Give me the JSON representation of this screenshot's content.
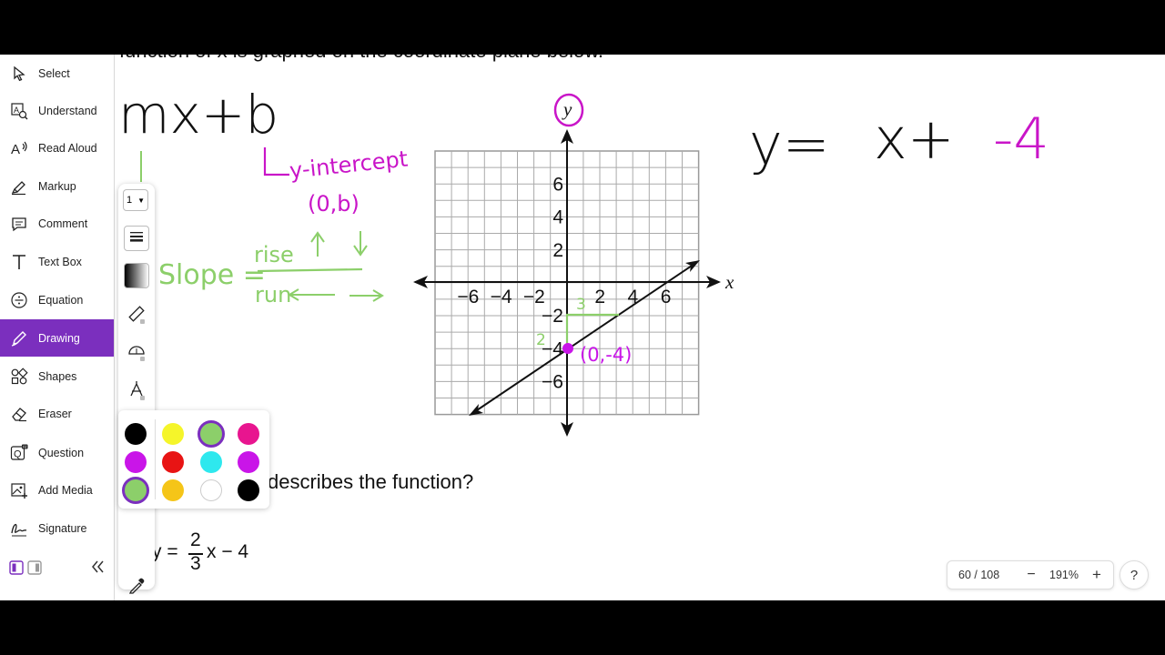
{
  "sidebar": {
    "items": [
      {
        "label": "Select",
        "icon": "cursor-icon"
      },
      {
        "label": "Understand",
        "icon": "understand-icon"
      },
      {
        "label": "Read Aloud",
        "icon": "read-aloud-icon"
      },
      {
        "label": "Markup",
        "icon": "highlighter-icon"
      },
      {
        "label": "Comment",
        "icon": "comment-icon"
      },
      {
        "label": "Text Box",
        "icon": "text-icon"
      },
      {
        "label": "Equation",
        "icon": "divide-icon"
      },
      {
        "label": "Drawing",
        "icon": "pencil-icon",
        "active": true
      },
      {
        "label": "Shapes",
        "icon": "shapes-icon"
      },
      {
        "label": "Eraser",
        "icon": "eraser-icon"
      },
      {
        "label": "Question",
        "icon": "question-ai-icon"
      },
      {
        "label": "Add Media",
        "icon": "media-icon"
      },
      {
        "label": "Signature",
        "icon": "signature-icon"
      }
    ],
    "collapse_icon": "double-chevron-left-icon"
  },
  "subtoolbar": {
    "pen_size": "1"
  },
  "palette": {
    "colors": [
      "#000000",
      "#f5f52a",
      "#8ccf6a",
      "#e8158f",
      "#c915e8",
      "#e81414",
      "#2ee8ee",
      "#b81ee8",
      "#8ccf6a",
      "#f5c518",
      "#ffffff",
      "#000000"
    ],
    "selected_accent": "#7b2fbe"
  },
  "document": {
    "top_text": "function of x is graphed on the coordinate plane below.",
    "question_text": "describes the function?",
    "answer_prefix": "y =",
    "answer_num": "2",
    "answer_den": "3",
    "answer_suffix": "x − 4"
  },
  "graph": {
    "x_label": "x",
    "y_label": "y",
    "x_ticks": [
      "−6",
      "−4",
      "−2",
      "2",
      "4",
      "6"
    ],
    "y_ticks": [
      "6",
      "4",
      "2",
      "−2",
      "−4",
      "−6"
    ],
    "point_label": "(0,-4)"
  },
  "ink": {
    "formula": "mx+b",
    "intercept_label": "y-intercept",
    "intercept_point": "(0,b)",
    "slope_word": "Slope =",
    "rise": "rise",
    "run": "run",
    "equation_left": "y=",
    "equation_mid": "x+",
    "equation_b": "-4",
    "rise_value": "2",
    "run_value": "3"
  },
  "zoom": {
    "page": "60 / 108",
    "minus": "−",
    "level": "191%",
    "plus": "+"
  },
  "help": "?"
}
